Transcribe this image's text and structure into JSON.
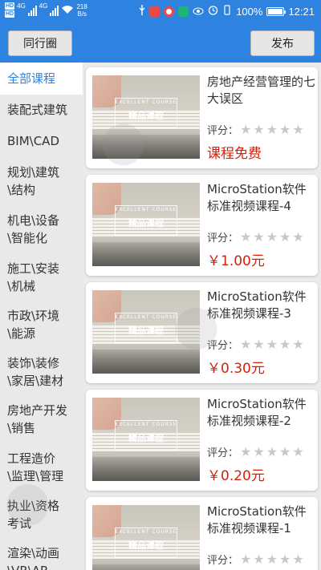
{
  "statusbar": {
    "hd1": "HD",
    "hd2": "HD",
    "net1": "4G",
    "net2": "4G",
    "speed_value": "218",
    "speed_unit": "B/s",
    "battery": "100%",
    "time": "12:21"
  },
  "toolbar": {
    "left_label": "同行圈",
    "right_label": "发布"
  },
  "sidebar": {
    "items": [
      {
        "label": "全部课程",
        "active": true
      },
      {
        "label": "装配式建筑"
      },
      {
        "label": "BIM\\CAD"
      },
      {
        "label": "规划\\建筑\\结构"
      },
      {
        "label": "机电\\设备\\智能化"
      },
      {
        "label": "施工\\安装\\机械"
      },
      {
        "label": "市政\\环境\\能源"
      },
      {
        "label": "装饰\\装修\\家居\\建材"
      },
      {
        "label": "房地产开发\\销售"
      },
      {
        "label": "工程造价\\监理\\管理"
      },
      {
        "label": "执业\\资格考试"
      },
      {
        "label": "渲染\\动画\\VR\\AR"
      }
    ]
  },
  "courses": {
    "rating_label": "评分：",
    "thumb_tag": "精品课程",
    "thumb_caption": "EXCELLENT COURSE",
    "items": [
      {
        "title": "房地产经营管理的七大误区",
        "price": "课程免费",
        "rating": 0
      },
      {
        "title": "MicroStation软件标准视频课程-4",
        "price": "￥1.00元",
        "rating": 0
      },
      {
        "title": "MicroStation软件标准视频课程-3",
        "price": "￥0.30元",
        "rating": 0
      },
      {
        "title": "MicroStation软件标准视频课程-2",
        "price": "￥0.20元",
        "rating": 0
      },
      {
        "title": "MicroStation软件标准视频课程-1",
        "price": "",
        "rating": 0
      }
    ]
  },
  "colors": {
    "primary": "#2f83e0",
    "price": "#d81e06",
    "star_empty": "#c8c8c8"
  }
}
